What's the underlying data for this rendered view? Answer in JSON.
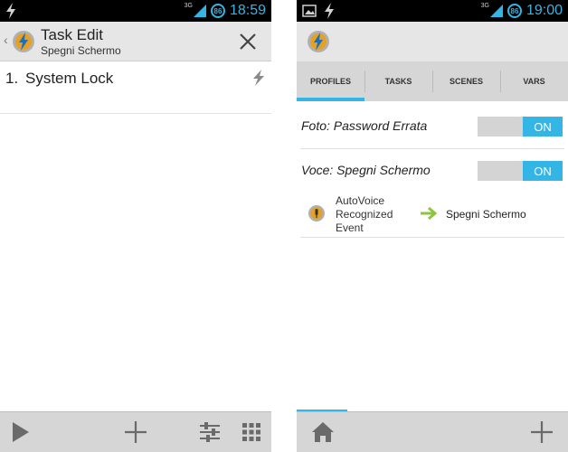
{
  "left_screen": {
    "statusbar": {
      "network": "3G",
      "battery": "86",
      "time": "18:59"
    },
    "header": {
      "title": "Task Edit",
      "subtitle": "Spegni Schermo"
    },
    "actions": [
      {
        "number": "1.",
        "name": "System Lock",
        "icon": "lightning-icon"
      }
    ],
    "bottombar": {
      "icons": [
        "play-icon",
        "plus-icon",
        "sliders-icon",
        "grid-icon"
      ]
    }
  },
  "right_screen": {
    "statusbar": {
      "network": "3G",
      "battery": "86",
      "time": "19:00"
    },
    "tabs": [
      {
        "label": "PROFILES",
        "active": true
      },
      {
        "label": "TASKS",
        "active": false
      },
      {
        "label": "SCENES",
        "active": false
      },
      {
        "label": "VARS",
        "active": false
      }
    ],
    "profiles": [
      {
        "name": "Foto: Password Errata",
        "toggle": "ON"
      },
      {
        "name": "Voce: Spegni Schermo",
        "toggle": "ON"
      }
    ],
    "context": {
      "event": "AutoVoice Recognized Event",
      "task": "Spegni Schermo"
    },
    "bottombar": {
      "icons": [
        "home-icon",
        "plus-icon"
      ]
    }
  },
  "colors": {
    "accent": "#33b5e5",
    "bar_bg": "#d6d6d6",
    "header_bg": "#e6e6e6",
    "arrow_green": "#8cc63f"
  }
}
